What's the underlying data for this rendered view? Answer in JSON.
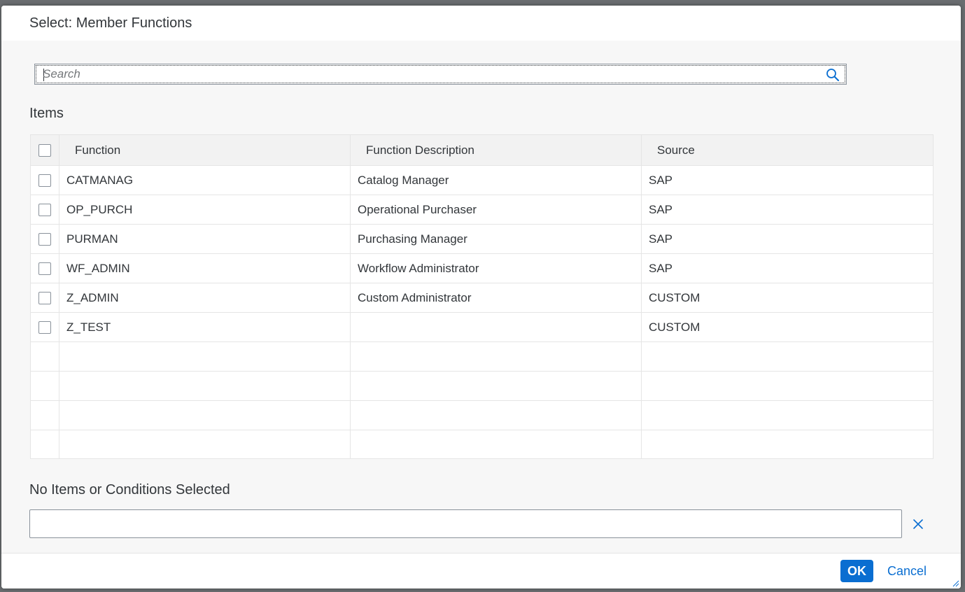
{
  "dialog": {
    "title": "Select: Member Functions"
  },
  "search": {
    "placeholder": "Search",
    "value": ""
  },
  "items": {
    "title": "Items",
    "columns": [
      "Function",
      "Function Description",
      "Source"
    ],
    "rows": [
      {
        "function": "CATMANAG",
        "description": "Catalog Manager",
        "source": "SAP"
      },
      {
        "function": "OP_PURCH",
        "description": "Operational Purchaser",
        "source": "SAP"
      },
      {
        "function": "PURMAN",
        "description": "Purchasing Manager",
        "source": "SAP"
      },
      {
        "function": "WF_ADMIN",
        "description": "Workflow Administrator",
        "source": "SAP"
      },
      {
        "function": "Z_ADMIN",
        "description": "Custom Administrator",
        "source": "CUSTOM"
      },
      {
        "function": "Z_TEST",
        "description": "",
        "source": "CUSTOM"
      }
    ],
    "empty_rows": 4
  },
  "selection": {
    "title": "No Items or Conditions Selected"
  },
  "footer": {
    "ok_label": "OK",
    "cancel_label": "Cancel"
  },
  "colors": {
    "accent": "#0a6ed1",
    "border": "#e5e5e5",
    "header_bg": "#f2f2f2"
  },
  "icons": {
    "search": "search-icon",
    "clear": "clear-icon",
    "resize": "resize-handle-icon"
  }
}
